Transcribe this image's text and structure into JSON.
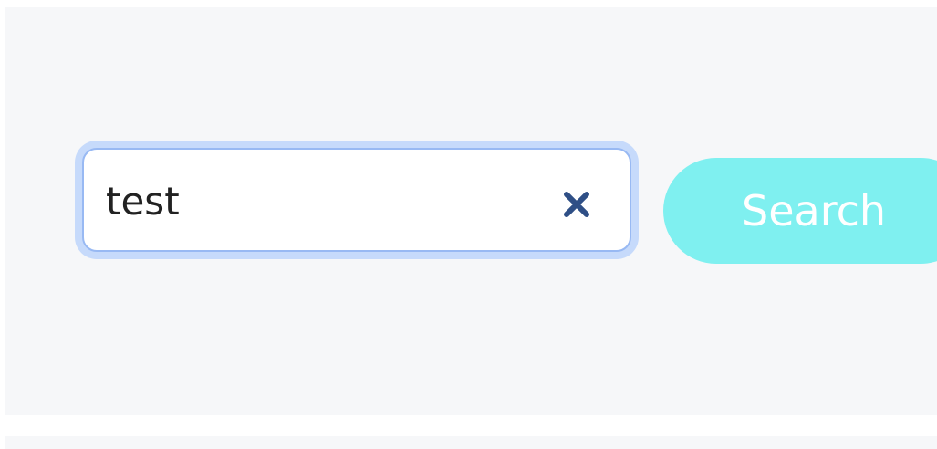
{
  "search": {
    "value": "test",
    "button_label": "Search"
  },
  "icons": {
    "clear": "close-icon"
  },
  "colors": {
    "panel": "#f6f7f9",
    "focus_ring": "#c6dafb",
    "button": "#7ff0f0",
    "clear_icon": "#2f4f86"
  }
}
